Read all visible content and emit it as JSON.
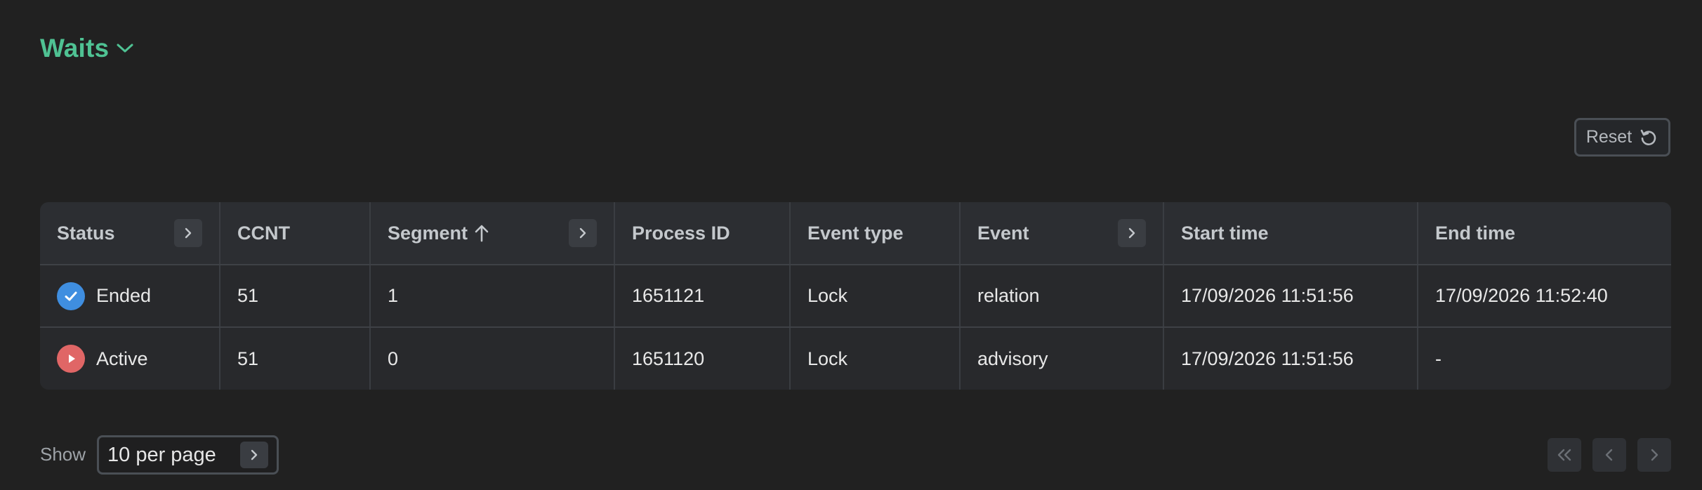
{
  "header": {
    "title": "Waits",
    "title_color": "#4fc293"
  },
  "toolbar": {
    "reset_label": "Reset",
    "reset_icon": "reset-icon"
  },
  "table": {
    "columns": [
      {
        "label": "Status",
        "expandable": true
      },
      {
        "label": "CCNT",
        "expandable": false
      },
      {
        "label": "Segment",
        "expandable": true,
        "sort": "ascending"
      },
      {
        "label": "Process ID",
        "expandable": false
      },
      {
        "label": "Event type",
        "expandable": false
      },
      {
        "label": "Event",
        "expandable": true
      },
      {
        "label": "Start time",
        "expandable": false
      },
      {
        "label": "End time",
        "expandable": false
      }
    ],
    "rows": [
      {
        "status": "Ended",
        "status_icon": "check-circle-icon",
        "status_color": "#3f8ee0",
        "ccnt": "51",
        "segment": "1",
        "process_id": "1651121",
        "event_type": "Lock",
        "event": "relation",
        "start_time": "17/09/2026 11:51:56",
        "end_time": "17/09/2026 11:52:40"
      },
      {
        "status": "Active",
        "status_icon": "play-circle-icon",
        "status_color": "#e06666",
        "ccnt": "51",
        "segment": "0",
        "process_id": "1651120",
        "event_type": "Lock",
        "event": "advisory",
        "start_time": "17/09/2026 11:51:56",
        "end_time": "-"
      }
    ]
  },
  "footer": {
    "show_label": "Show",
    "per_page_value": "10 per page"
  },
  "pagination": {
    "first_icon": "double-chevron-left-icon",
    "prev_icon": "chevron-left-icon",
    "next_icon": "chevron-right-icon"
  }
}
